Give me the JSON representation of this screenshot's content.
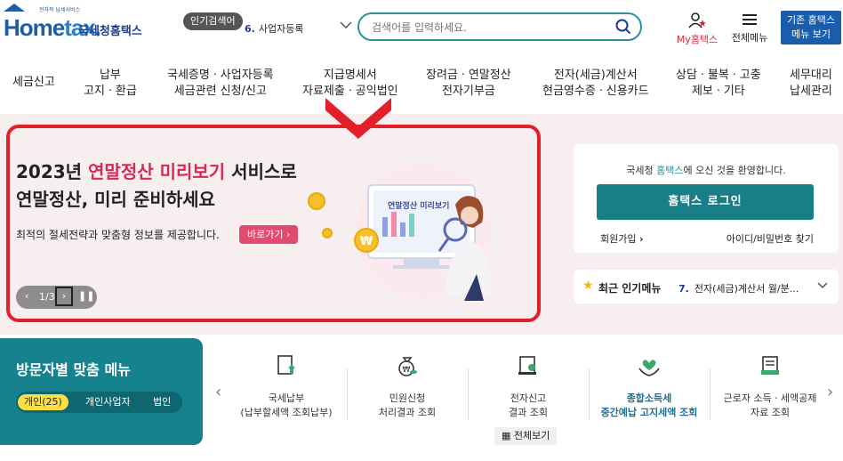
{
  "logo": {
    "top_text": "전자적 납세서비스",
    "brand": "Hometax",
    "name": "국세청홈택스"
  },
  "popular": {
    "badge": "인기검색어",
    "rank": "6.",
    "term": "사업자등록"
  },
  "search": {
    "placeholder": "검색어를 입력하세요."
  },
  "util": {
    "myhometax": "My홈택스",
    "allmenu": "전체메뉴",
    "oldmenu_line1": "기존 홈택스",
    "oldmenu_line2": "메뉴 보기"
  },
  "nav": [
    {
      "line1": "세금신고",
      "line2": ""
    },
    {
      "line1": "납부",
      "line2": "고지ㆍ환급"
    },
    {
      "line1": "국세증명ㆍ사업자등록",
      "line2": "세금관련 신청/신고"
    },
    {
      "line1": "지급명세서",
      "line2": "자료제출ㆍ공익법인"
    },
    {
      "line1": "장려금ㆍ연말정산",
      "line2": "전자기부금"
    },
    {
      "line1": "전자(세금)계산서",
      "line2": "현금영수증ㆍ신용카드"
    },
    {
      "line1": "상담ㆍ불복ㆍ고충",
      "line2": "제보ㆍ기타"
    },
    {
      "line1": "세무대리",
      "line2": "납세관리"
    }
  ],
  "hero": {
    "title_pre": "2023년 ",
    "title_hl": "연말정산 미리보기",
    "title_post": " 서비스로",
    "title2": "연말정산, 미리 준비하세요",
    "desc": "최적의 절세전략과 맞춤형 정보를 제공합니다.",
    "go": "바로가기",
    "page": "1/3",
    "screen_label": "연말정산 미리보기",
    "colors": {
      "highlight": "#d6285b",
      "frame": "#e2202a"
    }
  },
  "login": {
    "welcome_pre": "국세청 ",
    "welcome_hl": "홈택스",
    "welcome_post": "에 오신 것을 환영합니다.",
    "button": "홈택스 로그인",
    "join": "회원가입",
    "find": "아이디/비밀번호 찾기"
  },
  "recent": {
    "label": "최근 인기메뉴",
    "rank": "7.",
    "item": "전자(세금)계산서 월/분..."
  },
  "visitor": {
    "title": "방문자별 맞춤 메뉴",
    "tabs": [
      "개인(25)",
      "개인사업자",
      "법인"
    ]
  },
  "quick": [
    {
      "icon": "document-upload-icon",
      "line1": "국세납부",
      "line2": "(납부할세액 조회납부)"
    },
    {
      "icon": "money-bag-icon",
      "line1": "민원신청",
      "line2": "처리결과 조회"
    },
    {
      "icon": "certificate-icon",
      "line1": "전자신고",
      "line2": "결과 조회"
    },
    {
      "icon": "hand-heart-icon",
      "line1": "종합소득세",
      "line2": "중간예납 고지세액 조회"
    },
    {
      "icon": "income-document-icon",
      "line1": "근로자 소득ㆍ세액공제",
      "line2": "자료 조회"
    }
  ],
  "seeall": "전체보기"
}
